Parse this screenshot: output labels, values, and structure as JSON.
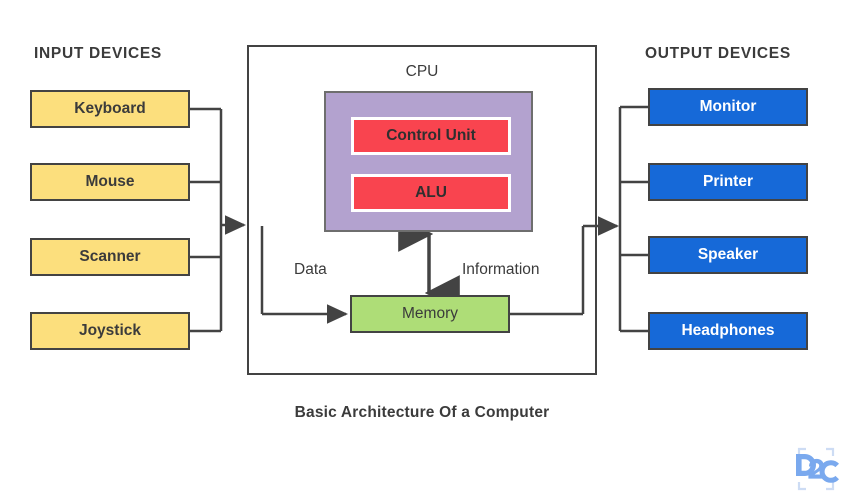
{
  "diagram": {
    "caption": "Basic Architecture Of a Computer",
    "input_section_title": "INPUT DEVICES",
    "output_section_title": "OUTPUT DEVICES",
    "cpu_title": "CPU",
    "input_devices": [
      {
        "label": "Keyboard"
      },
      {
        "label": "Mouse"
      },
      {
        "label": "Scanner"
      },
      {
        "label": "Joystick"
      }
    ],
    "output_devices": [
      {
        "label": "Monitor"
      },
      {
        "label": "Printer"
      },
      {
        "label": "Speaker"
      },
      {
        "label": "Headphones"
      }
    ],
    "cpu_units": [
      {
        "label": "Control Unit"
      },
      {
        "label": "ALU"
      }
    ],
    "memory": {
      "label": "Memory"
    },
    "flow_labels": {
      "data": "Data",
      "information": "Information"
    },
    "logo": {
      "text": "D2C"
    },
    "colors": {
      "input_fill": "#fcdf7d",
      "output_fill": "#1669d8",
      "cpu_inner_fill": "#b3a2cf",
      "unit_fill": "#f9444f",
      "memory_fill": "#aedd77",
      "stroke": "#434343",
      "text": "#3b3b3b",
      "logo_blue": "#7aa9ee",
      "background": "#ffffff"
    }
  }
}
